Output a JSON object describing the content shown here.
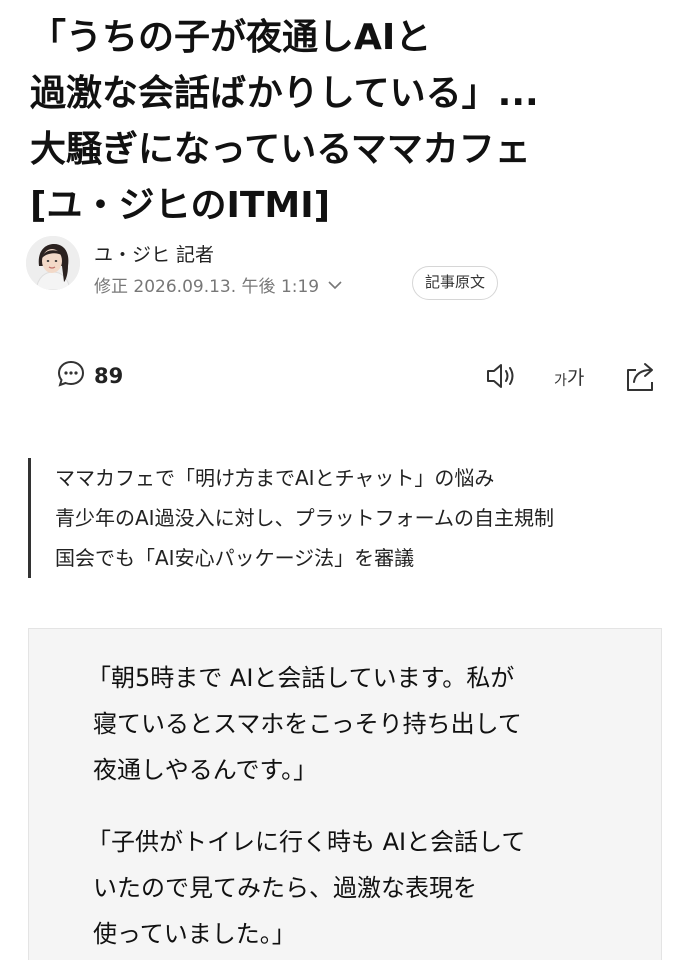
{
  "headline": {
    "lines": [
      "「うちの子が夜通しAIと",
      "過激な会話ばかりしている」...",
      "大騒ぎになっているママカフェ",
      "[ユ・ジヒのITMI]"
    ]
  },
  "byline": {
    "reporter": "ユ・ジヒ 記者",
    "datetime": "修正 2026.09.13. 午後 1:19",
    "source_button": "記事原文"
  },
  "toolbar": {
    "comment_count": "89",
    "font_label_small": "가",
    "font_label_large": "가",
    "icons": [
      "comment-icon",
      "speaker-icon",
      "font-size-icon",
      "share-icon"
    ]
  },
  "summary": {
    "lines": [
      "ママカフェで「明け方までAIとチャット」の悩み",
      "青少年のAI過没入に対し、プラットフォームの自主規制",
      "国会でも「AI安心パッケージ法」を審議"
    ]
  },
  "quotes": [
    {
      "lines": [
        "「朝5時まで AIと会話しています。私が",
        "寝ているとスマホをこっそり持ち出して",
        "夜通しやるんです。」"
      ]
    },
    {
      "lines": [
        "「子供がトイレに行く時も AIと会話して",
        "いたので見てみたら、過激な表現を",
        "使っていました。」"
      ]
    }
  ]
}
